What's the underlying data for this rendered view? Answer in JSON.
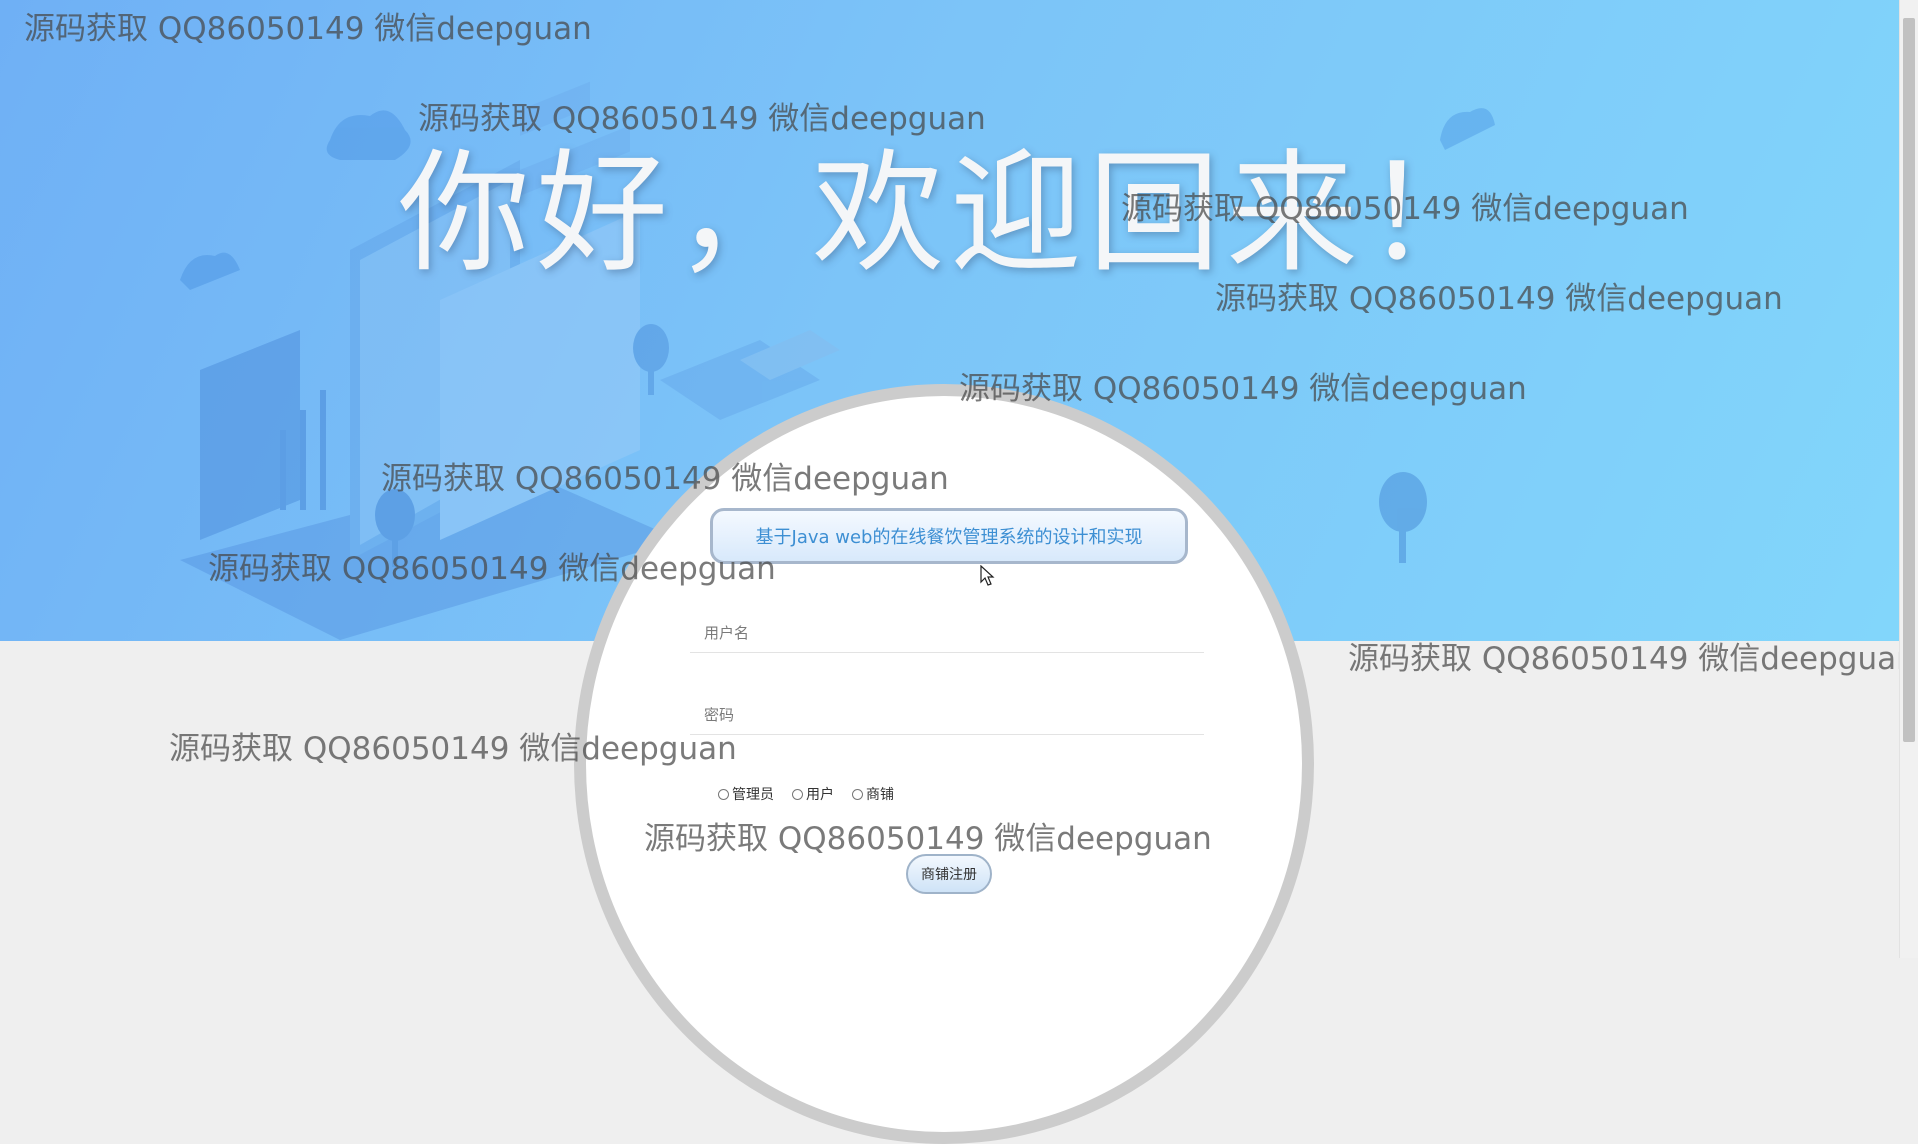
{
  "hero": {
    "headline": "你好，欢迎回来！"
  },
  "login": {
    "system_title": "基于Java web的在线餐饮管理系统的设计和实现",
    "username_placeholder": "用户名",
    "password_placeholder": "密码",
    "roles": [
      "管理员",
      "用户",
      "商铺"
    ],
    "register_label": "商铺注册"
  },
  "watermark": "源码获取 QQ86050149 微信deepguan",
  "colors": {
    "hero_start": "#6fb0f5",
    "hero_end": "#82d6fb",
    "title_text": "#3d8fd3",
    "page_bg": "#efefef"
  },
  "icons": {
    "cursor": "mouse-pointer-icon"
  }
}
